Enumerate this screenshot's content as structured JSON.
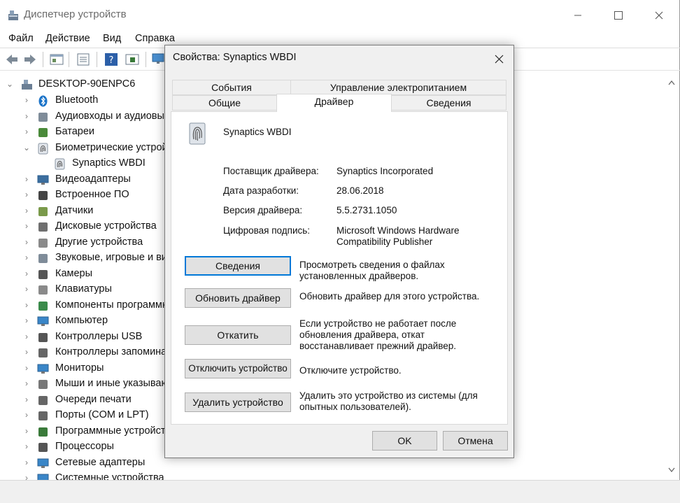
{
  "window": {
    "title": "Диспетчер устройств",
    "menu": [
      "Файл",
      "Действие",
      "Вид",
      "Справка"
    ]
  },
  "tree": {
    "root": "DESKTOP-90ENPC6",
    "items": [
      {
        "label": "Bluetooth",
        "icon": "bluetooth-icon",
        "expanded": false
      },
      {
        "label": "Аудиовходы и аудиовыходы",
        "icon": "speaker-icon",
        "expanded": false
      },
      {
        "label": "Батареи",
        "icon": "battery-icon",
        "expanded": false
      },
      {
        "label": "Биометрические устройства",
        "icon": "fingerprint-icon",
        "expanded": true
      },
      {
        "label": "Synaptics WBDI",
        "icon": "fingerprint-icon",
        "child": true
      },
      {
        "label": "Видеоадаптеры",
        "icon": "display-adapter-icon",
        "expanded": false
      },
      {
        "label": "Встроенное ПО",
        "icon": "chip-icon",
        "expanded": false
      },
      {
        "label": "Датчики",
        "icon": "sensor-icon",
        "expanded": false
      },
      {
        "label": "Дисковые устройства",
        "icon": "disk-icon",
        "expanded": false
      },
      {
        "label": "Другие устройства",
        "icon": "unknown-device-icon",
        "expanded": false
      },
      {
        "label": "Звуковые, игровые и видеоустройства",
        "icon": "speaker-icon",
        "expanded": false
      },
      {
        "label": "Камеры",
        "icon": "camera-icon",
        "expanded": false
      },
      {
        "label": "Клавиатуры",
        "icon": "keyboard-icon",
        "expanded": false
      },
      {
        "label": "Компоненты программного обеспечения",
        "icon": "component-icon",
        "expanded": false
      },
      {
        "label": "Компьютер",
        "icon": "monitor-icon",
        "expanded": false
      },
      {
        "label": "Контроллеры USB",
        "icon": "usb-icon",
        "expanded": false
      },
      {
        "label": "Контроллеры запоминающих устройств",
        "icon": "storage-controller-icon",
        "expanded": false
      },
      {
        "label": "Мониторы",
        "icon": "monitor-icon",
        "expanded": false
      },
      {
        "label": "Мыши и иные указывающие устройства",
        "icon": "mouse-icon",
        "expanded": false
      },
      {
        "label": "Очереди печати",
        "icon": "printer-icon",
        "expanded": false
      },
      {
        "label": "Порты (COM и LPT)",
        "icon": "port-icon",
        "expanded": false
      },
      {
        "label": "Программные устройства",
        "icon": "software-device-icon",
        "expanded": false
      },
      {
        "label": "Процессоры",
        "icon": "cpu-icon",
        "expanded": false
      },
      {
        "label": "Сетевые адаптеры",
        "icon": "network-icon",
        "expanded": false
      },
      {
        "label": "Системные устройства",
        "icon": "system-device-icon",
        "expanded": false
      }
    ]
  },
  "dialog": {
    "title": "Свойства: Synaptics WBDI",
    "tabs_row1": [
      "События",
      "Управление электропитанием"
    ],
    "tabs_row2": [
      "Общие",
      "Драйвер",
      "Сведения"
    ],
    "active_tab": "Драйвер",
    "device_name": "Synaptics WBDI",
    "fields": [
      {
        "label": "Поставщик драйвера:",
        "value": "Synaptics Incorporated"
      },
      {
        "label": "Дата разработки:",
        "value": "28.06.2018"
      },
      {
        "label": "Версия драйвера:",
        "value": "5.5.2731.1050"
      },
      {
        "label": "Цифровая подпись:",
        "value": "Microsoft Windows Hardware Compatibility Publisher"
      }
    ],
    "actions": [
      {
        "button": "Сведения",
        "desc": "Просмотреть сведения о файлах установленных драйверов."
      },
      {
        "button": "Обновить драйвер",
        "desc": "Обновить драйвер для этого устройства."
      },
      {
        "button": "Откатить",
        "desc": "Если устройство не работает после обновления драйвера, откат восстанавливает прежний драйвер."
      },
      {
        "button": "Отключить устройство",
        "desc": "Отключите устройство."
      },
      {
        "button": "Удалить устройство",
        "desc": "Удалить это устройство из системы (для опытных пользователей)."
      }
    ],
    "ok": "OK",
    "cancel": "Отмена"
  },
  "colors": {
    "accent": "#0078d7",
    "dialog_bg": "#f0f0f0",
    "button_bg": "#e1e1e1"
  }
}
